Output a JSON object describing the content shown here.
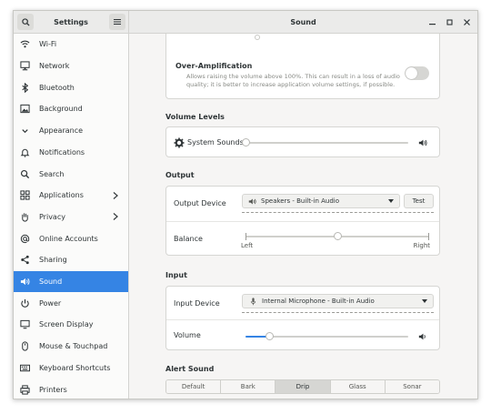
{
  "window": {
    "sidebar_title": "Settings",
    "title": "Sound"
  },
  "sidebar": {
    "items": [
      {
        "label": "Wi-Fi",
        "icon": "wifi-icon"
      },
      {
        "label": "Network",
        "icon": "network-icon"
      },
      {
        "label": "Bluetooth",
        "icon": "bluetooth-icon"
      },
      {
        "label": "Background",
        "icon": "background-icon"
      },
      {
        "label": "Appearance",
        "icon": "appearance-icon"
      },
      {
        "label": "Notifications",
        "icon": "bell-icon"
      },
      {
        "label": "Search",
        "icon": "search-icon"
      },
      {
        "label": "Applications",
        "icon": "applications-icon",
        "submenu": true
      },
      {
        "label": "Privacy",
        "icon": "hand-icon",
        "submenu": true
      },
      {
        "label": "Online Accounts",
        "icon": "at-icon"
      },
      {
        "label": "Sharing",
        "icon": "share-icon"
      },
      {
        "label": "Sound",
        "icon": "speaker-icon",
        "active": true
      },
      {
        "label": "Power",
        "icon": "power-icon"
      },
      {
        "label": "Screen Display",
        "icon": "display-icon"
      },
      {
        "label": "Mouse & Touchpad",
        "icon": "mouse-icon"
      },
      {
        "label": "Keyboard Shortcuts",
        "icon": "keyboard-icon"
      },
      {
        "label": "Printers",
        "icon": "printer-icon"
      }
    ]
  },
  "over_amplification": {
    "title": "Over-Amplification",
    "description_line1": "Allows raising the volume above 100%. This can result in a loss of audio",
    "description_line2": "quality; it is better to increase application volume settings, if possible.",
    "enabled": false
  },
  "volume_levels": {
    "section": "Volume Levels",
    "system_sounds_label": "System Sounds",
    "system_sounds_level": 0.0
  },
  "output": {
    "section": "Output",
    "device_label": "Output Device",
    "device_value": "Speakers - Built-in Audio",
    "test_label": "Test",
    "balance_label": "Balance",
    "balance_left": "Left",
    "balance_right": "Right",
    "balance_value": 0.5
  },
  "input": {
    "section": "Input",
    "device_label": "Input Device",
    "device_value": "Internal Microphone - Built-in Audio",
    "volume_label": "Volume",
    "volume_level": 0.15
  },
  "alert_sound": {
    "section": "Alert Sound",
    "options": [
      "Default",
      "Bark",
      "Drip",
      "Glass",
      "Sonar"
    ],
    "selected": "Drip"
  },
  "colors": {
    "accent": "#3584e4",
    "header": "#ebebea",
    "content_bg": "#f6f5f4"
  }
}
